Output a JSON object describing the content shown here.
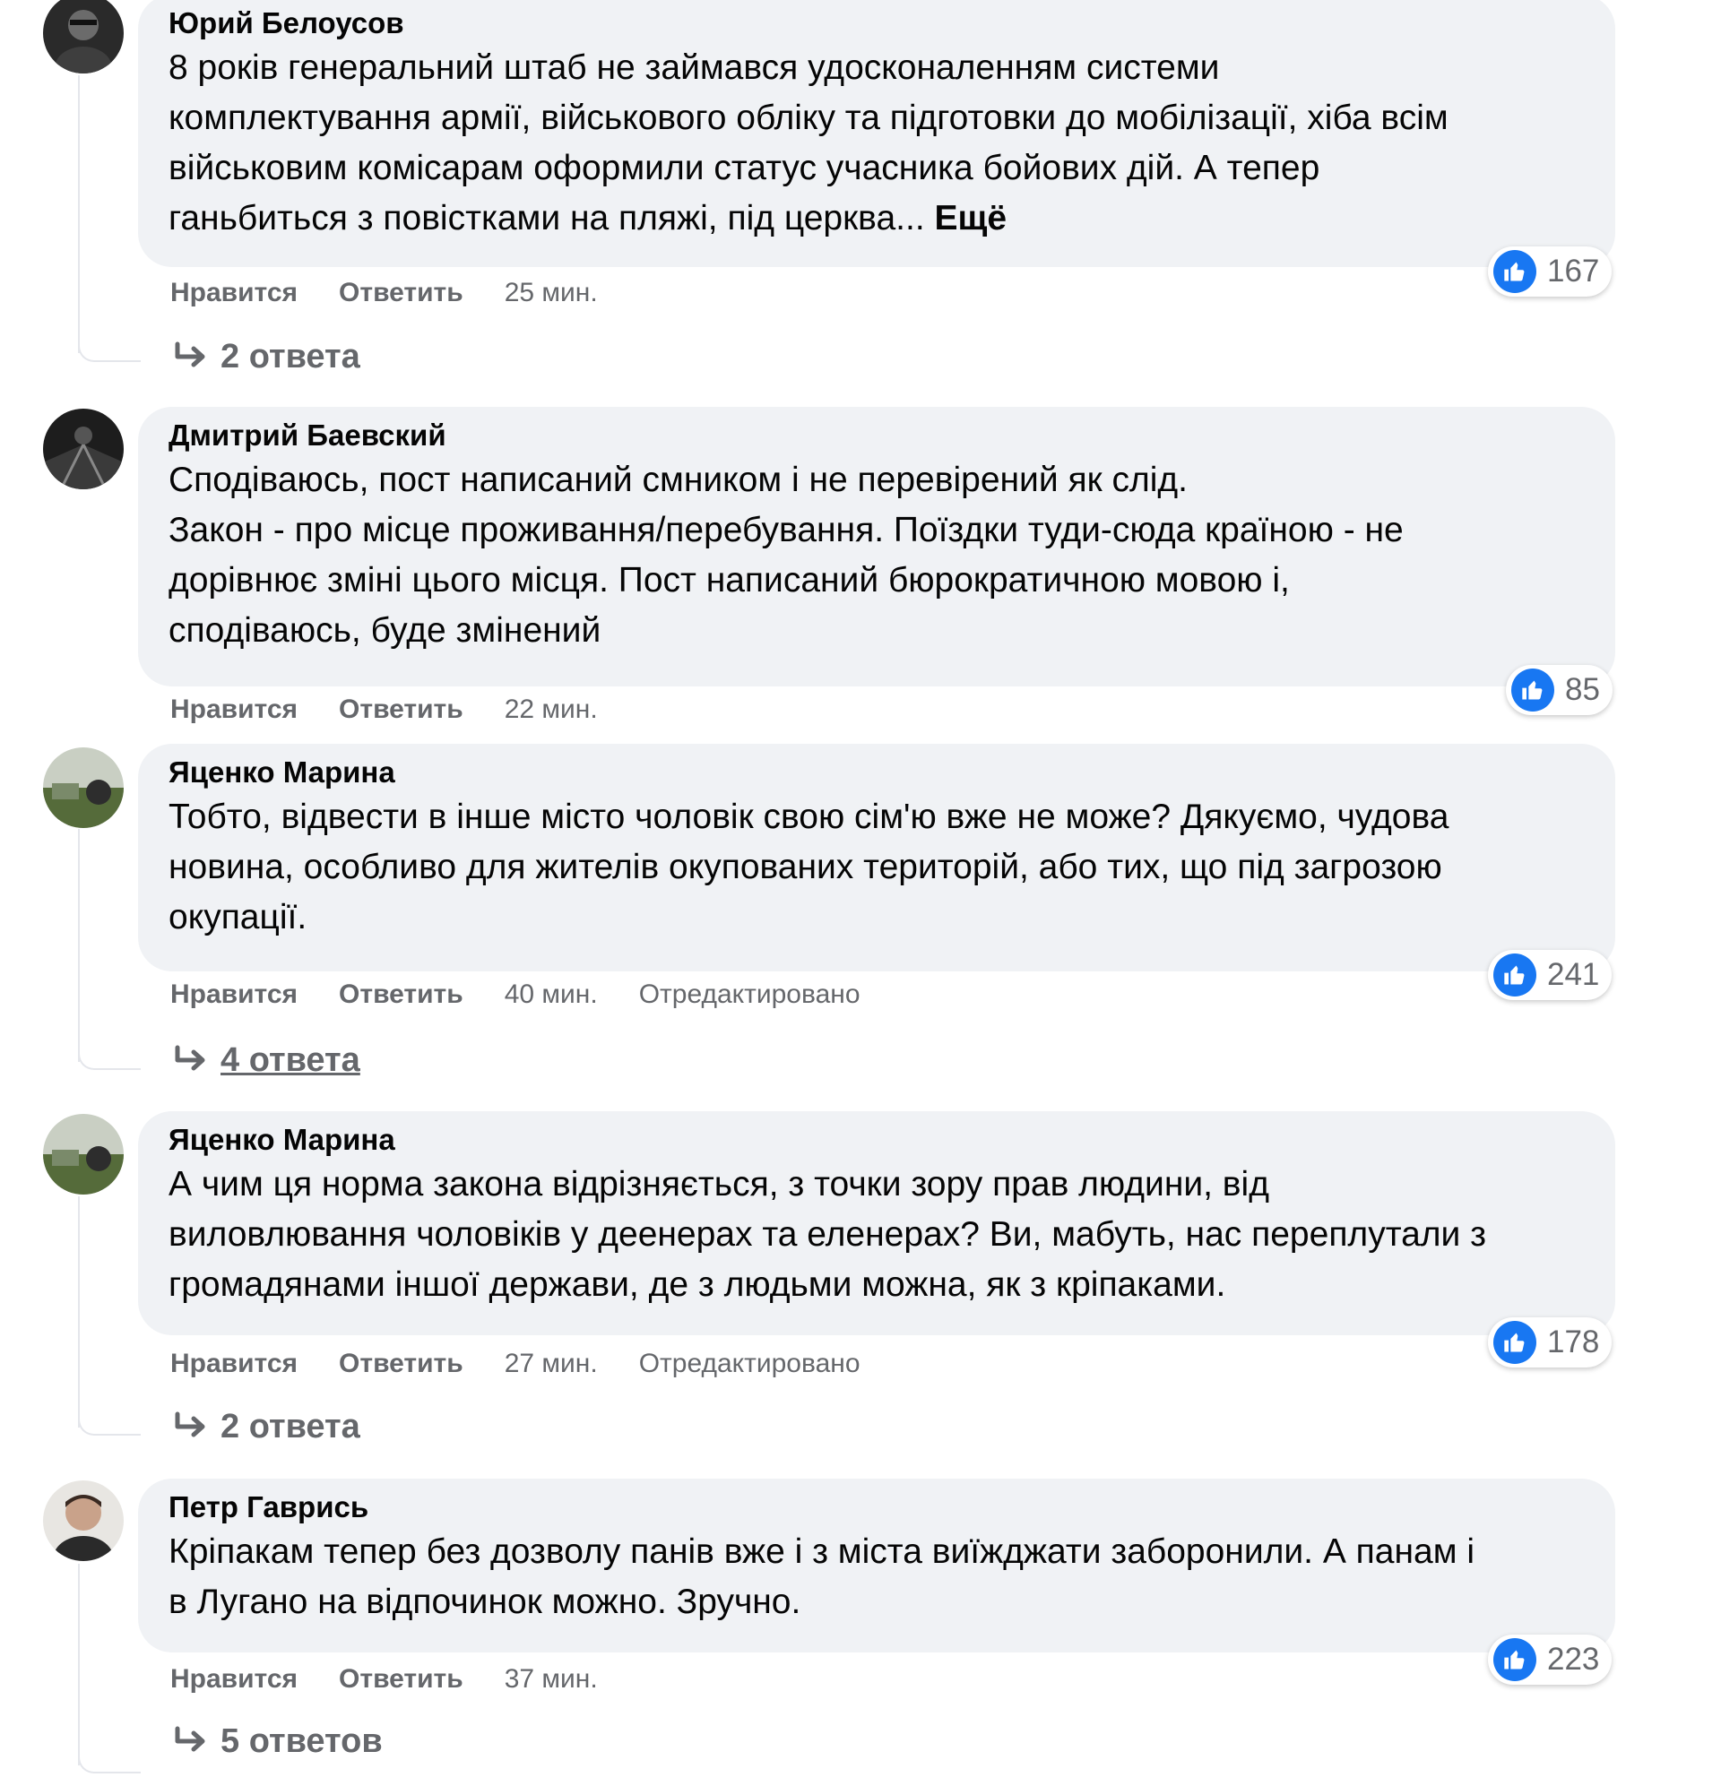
{
  "comments": [
    {
      "author": "Юрий Белоусов",
      "text": "8 років генеральний штаб не займався удосконаленням системи\nкомплектування армії, військового обліку та підготовки до мобілізації, хіба всім\nвійськовим комісарам оформили статус учасника бойових дій. А тепер\nганьбиться з повістками на пляжі, під церква...",
      "more_label": "Ещё",
      "reaction_count": "167",
      "like_label": "Нравится",
      "reply_label": "Ответить",
      "time": "25 мин.",
      "edited": "",
      "replies_label": "2 ответа"
    },
    {
      "author": "Дмитрий Баевский",
      "text": "Сподіваюсь, пост написаний смником і не перевірений як слід.\nЗакон - про місце проживання/перебування. Поїздки туди-сюда країною - не\nдорівнює зміні цього місця. Пост написаний бюрократичною мовою і,\nсподіваюсь, буде змінений",
      "reaction_count": "85",
      "like_label": "Нравится",
      "reply_label": "Ответить",
      "time": "22 мин."
    },
    {
      "author": "Яценко Марина",
      "text": "Тобто, відвести в інше місто чоловік свою сім'ю вже не може? Дякуємо, чудова\nновина, особливо для жителів окупованих територій, або тих, що під загрозою\nокупації.",
      "reaction_count": "241",
      "like_label": "Нравится",
      "reply_label": "Ответить",
      "time": "40 мин.",
      "edited": "Отредактировано",
      "replies_label": "4 ответа"
    },
    {
      "author": "Яценко Марина",
      "text": "А чим ця норма закона відрізняється, з точки зору прав людини, від\nвиловлювання чоловіків у деенерах та еленерах? Ви, мабуть, нас переплутали з\nгромадянами іншої держави, де з людьми можна, як з кріпаками.",
      "reaction_count": "178",
      "like_label": "Нравится",
      "reply_label": "Ответить",
      "time": "27 мин.",
      "edited": "Отредактировано",
      "replies_label": "2 ответа"
    },
    {
      "author": "Петр Гаврись",
      "text": "Кріпакам тепер без дозволу панів вже і з міста виїжджати заборонили. А панам і\nв Лугано на відпочинок можно. Зручно.",
      "reaction_count": "223",
      "like_label": "Нравится",
      "reply_label": "Ответить",
      "time": "37 мин.",
      "replies_label": "5 ответов"
    }
  ],
  "colors": {
    "bubble": "#f0f2f5",
    "like_blue": "#1877f2",
    "secondary_text": "#65676b",
    "thread_line": "#e4e6eb"
  },
  "icons": {
    "like": "thumbs-up-icon",
    "reply_arrow": "reply-arrow-icon"
  }
}
